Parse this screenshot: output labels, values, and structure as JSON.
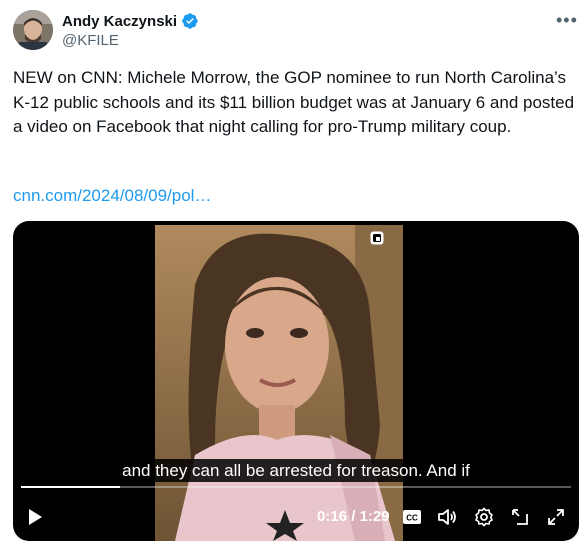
{
  "author": {
    "name": "Andy Kaczynski",
    "handle": "@KFILE"
  },
  "tweet": {
    "text": "NEW on CNN: Michele Morrow, the GOP nominee to run North Carolina’s K-12 public schools and its $11 billion budget was at January 6 and posted a video on Facebook that night calling for pro-Trump military coup.",
    "link": "cnn.com/2024/08/09/pol…"
  },
  "video": {
    "caption": "and they can all be arrested for treason. And if",
    "time": "0:16 / 1:29",
    "progress": 0.18
  },
  "colors": {
    "accent": "#1d9bf0",
    "text": "#0f1419",
    "muted": "#536471"
  }
}
